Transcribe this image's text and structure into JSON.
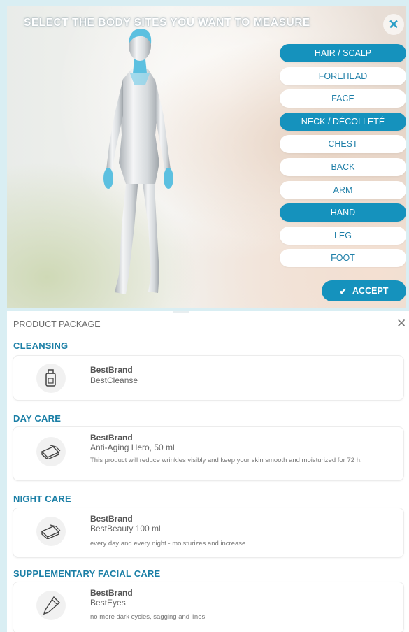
{
  "selector": {
    "title": "SELECT THE BODY SITES YOU WANT TO MEASURE",
    "close_icon": "close-icon",
    "sites": [
      {
        "label": "HAIR / SCALP",
        "selected": true
      },
      {
        "label": "FOREHEAD",
        "selected": false
      },
      {
        "label": "FACE",
        "selected": false
      },
      {
        "label": "NECK / DÉCOLLETÉ",
        "selected": true
      },
      {
        "label": "CHEST",
        "selected": false
      },
      {
        "label": "BACK",
        "selected": false
      },
      {
        "label": "ARM",
        "selected": false
      },
      {
        "label": "HAND",
        "selected": true
      },
      {
        "label": "LEG",
        "selected": false
      },
      {
        "label": "FOOT",
        "selected": false
      }
    ],
    "accept_label": "ACCEPT",
    "colors": {
      "accent": "#1592bd",
      "highlight": "#5cc0e0"
    }
  },
  "package": {
    "title": "PRODUCT PACKAGE",
    "categories": [
      {
        "name": "CLEANSING",
        "icon": "bottle-icon",
        "brand": "BestBrand",
        "product": "BestCleanse",
        "description": ""
      },
      {
        "name": "DAY CARE",
        "icon": "cream-jar-icon",
        "brand": "BestBrand",
        "product": "Anti-Aging Hero, 50 ml",
        "description": "This product will reduce wrinkles visibly and keep your skin smooth and moisturized for 72 h."
      },
      {
        "name": "NIGHT CARE",
        "icon": "cream-jar-icon",
        "brand": "BestBrand",
        "product": "BestBeauty 100 ml",
        "description": "every day and every night - moisturizes and increase"
      },
      {
        "name": "SUPPLEMENTARY FACIAL CARE",
        "icon": "tube-icon",
        "brand": "BestBrand",
        "product": "BestEyes",
        "description": "no more dark cycles, sagging and lines"
      }
    ]
  }
}
